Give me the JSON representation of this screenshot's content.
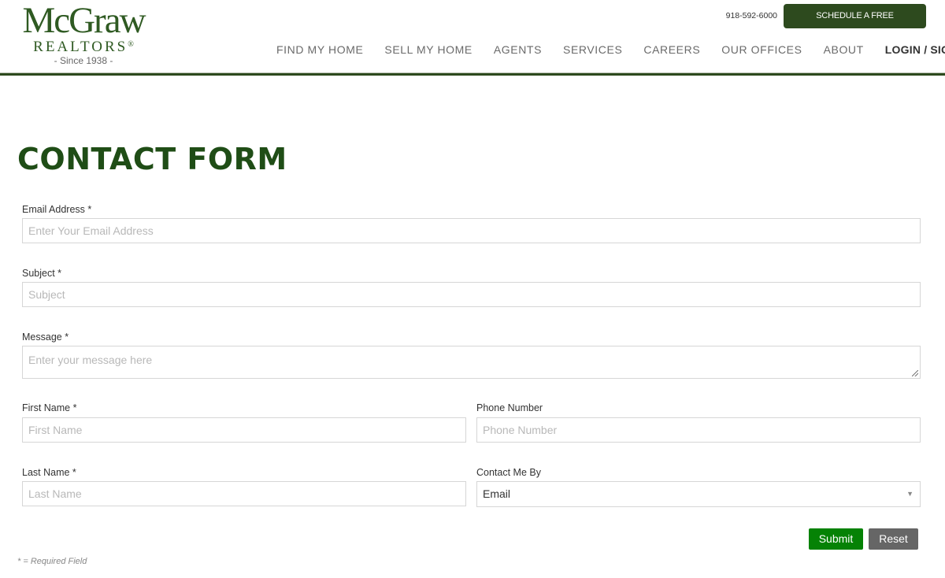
{
  "header": {
    "logo": {
      "main": "McGraw",
      "sub": "REALTORS",
      "registered": "®",
      "since": "- Since 1938 -"
    },
    "phone": "918-592-6000",
    "consult_button": "SCHEDULE A FREE CONSULTATION",
    "nav": [
      {
        "label": "FIND MY HOME"
      },
      {
        "label": "SELL MY HOME"
      },
      {
        "label": "AGENTS"
      },
      {
        "label": "SERVICES"
      },
      {
        "label": "CAREERS"
      },
      {
        "label": "OUR OFFICES"
      },
      {
        "label": "ABOUT"
      },
      {
        "label": "LOGIN / SIGN UP"
      }
    ],
    "accent_color": "#2d4a1e"
  },
  "page": {
    "title": "CONTACT FORM",
    "title_color": "#1f4d16"
  },
  "form": {
    "email": {
      "label": "Email Address *",
      "placeholder": "Enter Your Email Address",
      "value": ""
    },
    "subject": {
      "label": "Subject *",
      "placeholder": "Subject",
      "value": ""
    },
    "message": {
      "label": "Message *",
      "placeholder": "Enter your message here",
      "value": ""
    },
    "first_name": {
      "label": "First Name *",
      "placeholder": "First Name",
      "value": ""
    },
    "phone": {
      "label": "Phone Number",
      "placeholder": "Phone Number",
      "value": ""
    },
    "last_name": {
      "label": "Last Name *",
      "placeholder": "Last Name",
      "value": ""
    },
    "contact_by": {
      "label": "Contact Me By",
      "selected": "Email"
    },
    "submit_label": "Submit",
    "reset_label": "Reset",
    "submit_color": "#058205",
    "reset_color": "#666666",
    "required_note": "* = Required Field"
  }
}
